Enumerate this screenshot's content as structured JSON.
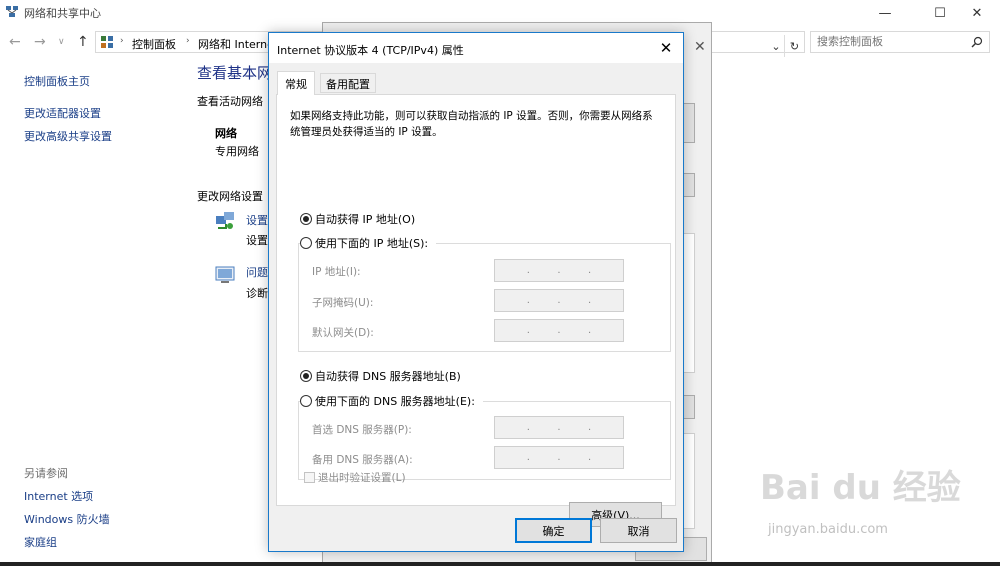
{
  "window": {
    "title": "网络和共享中心",
    "controls": {
      "minimize": "—",
      "maximize": "☐",
      "close": "✕"
    }
  },
  "address": {
    "crumbs": [
      "控制面板",
      "网络和 Interne"
    ],
    "search_placeholder": "搜索控制面板"
  },
  "sidebar": {
    "links": [
      "控制面板主页",
      "更改适配器设置",
      "更改高级共享设置"
    ],
    "see_also_heading": "另请参阅",
    "see_also": [
      "Internet 选项",
      "Windows 防火墙",
      "家庭组"
    ]
  },
  "main": {
    "heading": "查看基本网",
    "active_label": "查看活动网络",
    "network_name": "网络",
    "network_type": "专用网络",
    "change_label": "更改网络设置",
    "item1_link": "设置",
    "item1_desc": "设置",
    "item2_link": "问题",
    "item2_desc": "诊断"
  },
  "dialog": {
    "title": "Internet 协议版本 4 (TCP/IPv4) 属性",
    "close": "✕",
    "tabs": [
      "常规",
      "备用配置"
    ],
    "description": "如果网络支持此功能，则可以获取自动指派的 IP 设置。否则，你需要从网络系统管理员处获得适当的 IP 设置。",
    "ip_auto": "自动获得 IP 地址(O)",
    "ip_manual": "使用下面的 IP 地址(S):",
    "ip_fields": [
      "IP 地址(I):",
      "子网掩码(U):",
      "默认网关(D):"
    ],
    "dns_auto": "自动获得 DNS 服务器地址(B)",
    "dns_manual": "使用下面的 DNS 服务器地址(E):",
    "dns_fields": [
      "首选 DNS 服务器(P):",
      "备用 DNS 服务器(A):"
    ],
    "validate": "退出时验证设置(L)",
    "advanced": "高级(V)...",
    "ok": "确定",
    "cancel": "取消"
  },
  "watermark": {
    "brand": "Bai du 经验",
    "url": "jingyan.baidu.com"
  }
}
